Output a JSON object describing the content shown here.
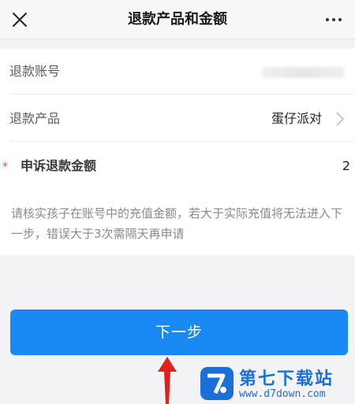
{
  "header": {
    "title": "退款产品和金额"
  },
  "form": {
    "account_label": "退款账号",
    "product_label": "退款产品",
    "product_value": "蛋仔派对",
    "required_mark": "*",
    "amount_label": "申诉退款金额",
    "amount_value": "2",
    "notice": "请核实孩子在账号中的充值金额，若大于实际充值将无法进入下一步，错误大于3次需隔天再申请"
  },
  "actions": {
    "next_label": "下一步"
  },
  "watermark": {
    "name": "第七下载站",
    "url": "www.d7down.com"
  },
  "colors": {
    "accent": "#1989f3",
    "required": "#e34a4a",
    "arrow": "#e0201b"
  }
}
